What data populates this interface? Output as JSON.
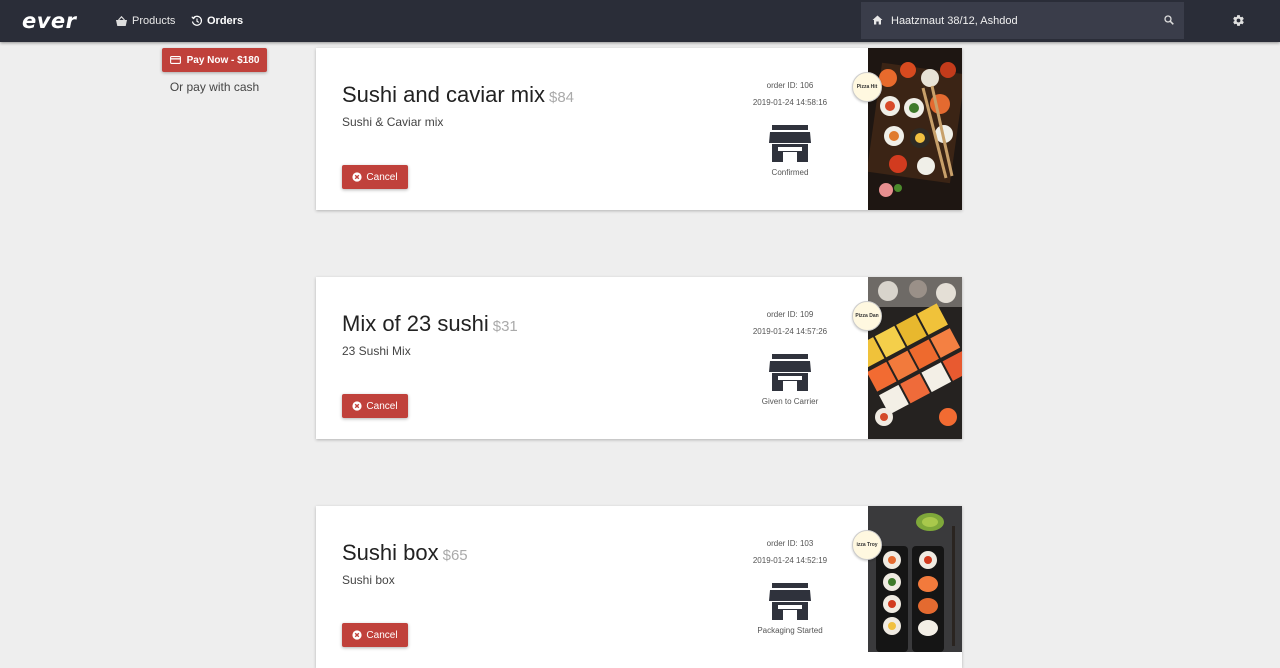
{
  "header": {
    "logo": "ever",
    "nav": [
      {
        "label": "Products",
        "icon": "basket-icon"
      },
      {
        "label": "Orders",
        "icon": "history-icon"
      }
    ],
    "address": "Haatzmaut 38/12, Ashdod",
    "search_icon": "search-icon",
    "settings_icon": "gear-icon"
  },
  "payment": {
    "pay_now_label": "Pay Now - $180",
    "cash_label": "Or pay with cash"
  },
  "orders": [
    {
      "title": "Sushi and caviar mix",
      "price": "$84",
      "description": "Sushi & Caviar mix",
      "cancel_label": "Cancel",
      "order_id": "order ID: 106",
      "date": "2019-01-24 14:58:16",
      "status": "Confirmed",
      "store_badge": "Pizza Hit"
    },
    {
      "title": "Mix of 23 sushi",
      "price": "$31",
      "description": "23 Sushi Mix",
      "cancel_label": "Cancel",
      "order_id": "order ID: 109",
      "date": "2019-01-24 14:57:26",
      "status": "Given to Carrier",
      "store_badge": "Pizza Dan"
    },
    {
      "title": "Sushi box",
      "price": "$65",
      "description": "Sushi box",
      "cancel_label": "Cancel",
      "order_id": "order ID: 103",
      "date": "2019-01-24 14:52:19",
      "status": "Packaging Started",
      "store_badge": "izza Troy"
    }
  ],
  "colors": {
    "topbar": "#2a2d38",
    "accent_red": "#c0413b",
    "background": "#eeeeee"
  }
}
